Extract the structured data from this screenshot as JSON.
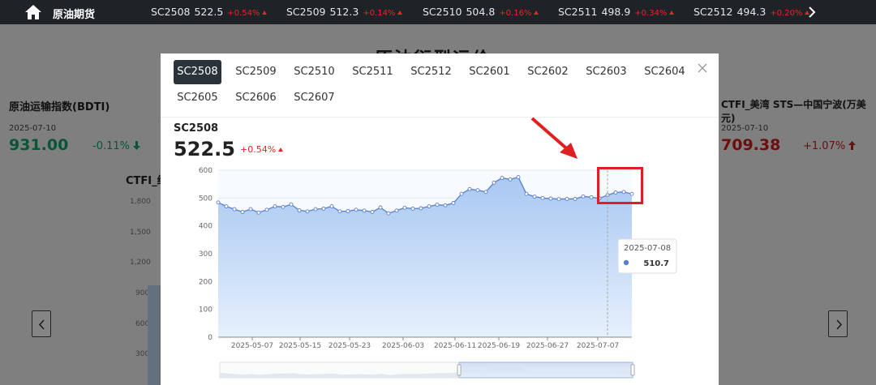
{
  "topbar": {
    "brand": "原油期货",
    "tickers": [
      {
        "name": "SC2508",
        "price": "522.5",
        "change": "+0.54%"
      },
      {
        "name": "SC2509",
        "price": "512.3",
        "change": "+0.14%"
      },
      {
        "name": "SC2510",
        "price": "504.8",
        "change": "+0.16%"
      },
      {
        "name": "SC2511",
        "price": "498.9",
        "change": "+0.34%"
      },
      {
        "name": "SC2512",
        "price": "494.3",
        "change": "+0.20%"
      }
    ]
  },
  "background": {
    "page_title": "原油衍型运价",
    "left_card": {
      "title": "原油运输指数(BDTI)",
      "date": "2025-07-10",
      "value": "931.00",
      "change": "-0.11%"
    },
    "left_chart": {
      "title": "CTFI_综",
      "yticks": [
        "1,800",
        "1,500",
        "1,200",
        "900",
        "600",
        "300"
      ]
    },
    "right_card": {
      "title": "CTFI_美湾 STS—中国宁波(万美元)",
      "date": "2025-07-10",
      "value": "709.38",
      "change": "+1.07%"
    }
  },
  "modal": {
    "tabs": [
      "SC2508",
      "SC2509",
      "SC2510",
      "SC2511",
      "SC2512",
      "SC2601",
      "SC2602",
      "SC2603",
      "SC2604",
      "SC2605",
      "SC2606",
      "SC2607"
    ],
    "active_tab": "SC2508",
    "contract_name": "SC2508",
    "price": "522.5",
    "change": "+0.54%",
    "tooltip": {
      "date": "2025-07-08",
      "value": "510.7"
    }
  },
  "colors": {
    "up": "#e02828",
    "down": "#13a36a",
    "line": "#5b7fc9",
    "annotation": "#e02020"
  },
  "chart_data": {
    "type": "area",
    "ylim": [
      0,
      600
    ],
    "yticks": [
      0,
      100,
      200,
      300,
      400,
      500,
      600
    ],
    "x_ticklabels": [
      "2025-05-07",
      "2025-05-15",
      "2025-05-23",
      "2025-06-03",
      "2025-06-11",
      "2025-06-19",
      "2025-06-27",
      "2025-07-07"
    ],
    "values": [
      484,
      470,
      460,
      450,
      460,
      448,
      458,
      470,
      468,
      477,
      456,
      452,
      460,
      462,
      470,
      452,
      453,
      458,
      455,
      450,
      466,
      445,
      455,
      465,
      462,
      463,
      470,
      476,
      474,
      482,
      515,
      532,
      528,
      522,
      555,
      572,
      567,
      575,
      515,
      505,
      500,
      498,
      496,
      497,
      497,
      506,
      503,
      499,
      510.7,
      520,
      522,
      515
    ]
  }
}
